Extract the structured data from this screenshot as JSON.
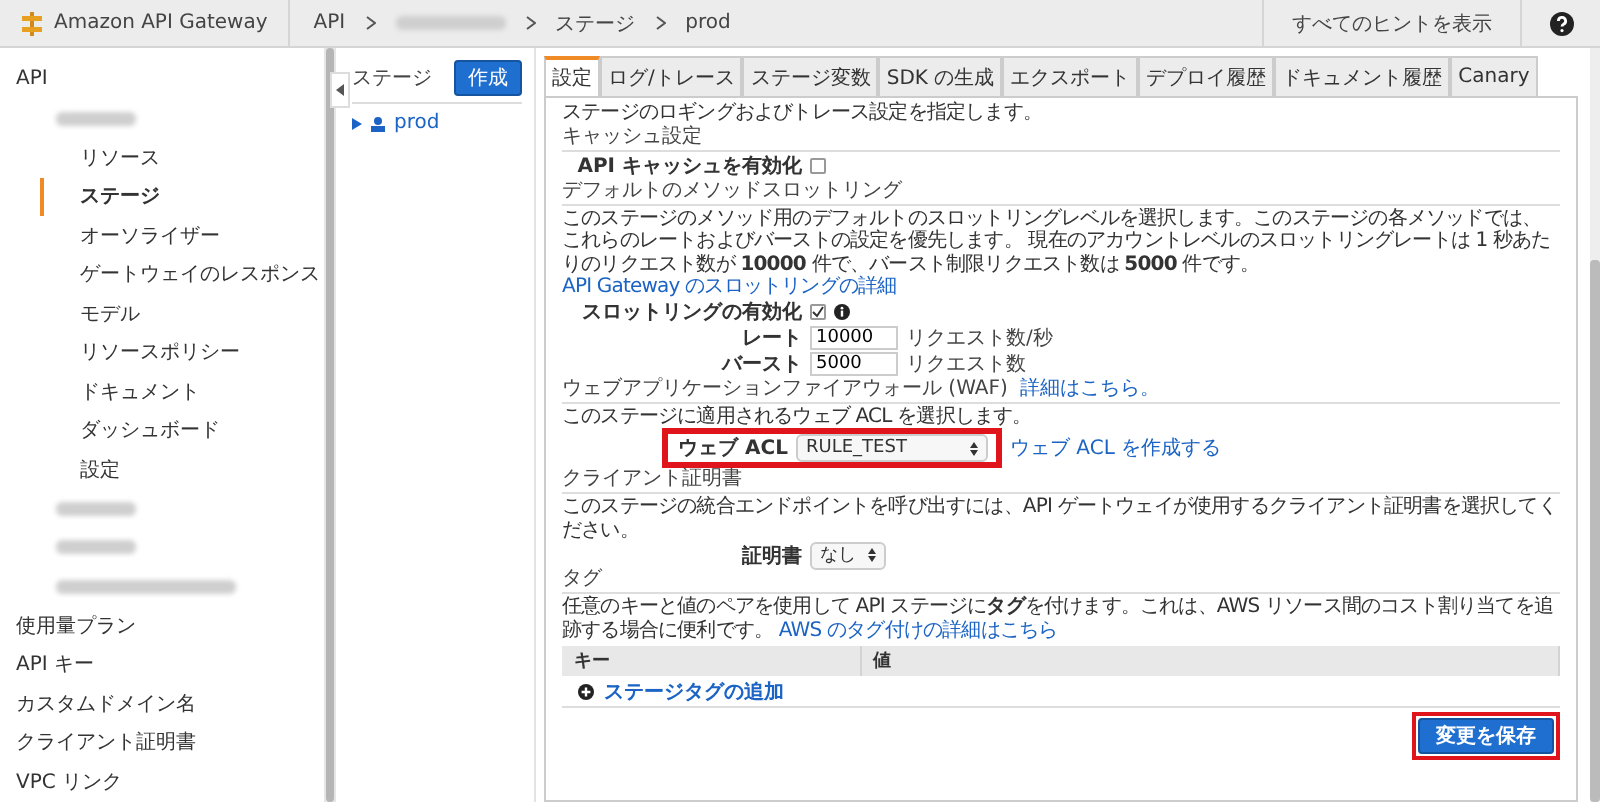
{
  "header": {
    "product": "Amazon API Gateway",
    "breadcrumb": [
      {
        "kind": "text",
        "label": "API"
      },
      {
        "kind": "blurred"
      },
      {
        "kind": "text",
        "label": "ステージ"
      },
      {
        "kind": "text",
        "label": "prod"
      }
    ],
    "hints_button": "すべてのヒントを表示"
  },
  "sidebar": {
    "items": [
      {
        "kind": "text",
        "label": "API",
        "selected": false,
        "children": [
          {
            "kind": "blurred",
            "selected": false,
            "children": [
              {
                "kind": "text",
                "label": "リソース",
                "selected": false
              },
              {
                "kind": "text",
                "label": "ステージ",
                "selected": true
              },
              {
                "kind": "text",
                "label": "オーソライザー",
                "selected": false
              },
              {
                "kind": "text",
                "label": "ゲートウェイのレスポンス",
                "selected": false
              },
              {
                "kind": "text",
                "label": "モデル",
                "selected": false
              },
              {
                "kind": "text",
                "label": "リソースポリシー",
                "selected": false
              },
              {
                "kind": "text",
                "label": "ドキュメント",
                "selected": false
              },
              {
                "kind": "text",
                "label": "ダッシュボード",
                "selected": false
              },
              {
                "kind": "text",
                "label": "設定",
                "selected": false
              }
            ]
          },
          {
            "kind": "blurred",
            "selected": false
          },
          {
            "kind": "blurred",
            "selected": false
          },
          {
            "kind": "blurred",
            "selected": false
          }
        ]
      },
      {
        "kind": "text",
        "label": "使用量プラン",
        "selected": false
      },
      {
        "kind": "text",
        "label": "API キー",
        "selected": false
      },
      {
        "kind": "text",
        "label": "カスタムドメイン名",
        "selected": false
      },
      {
        "kind": "text",
        "label": "クライアント証明書",
        "selected": false
      },
      {
        "kind": "text",
        "label": "VPC リンク",
        "selected": false
      }
    ]
  },
  "stages": {
    "title": "ステージ",
    "create_button": "作成",
    "items": [
      {
        "label": "prod",
        "expanded": false
      }
    ]
  },
  "tabs": [
    {
      "label": "設定",
      "selected": true
    },
    {
      "label": "ログ/トレース",
      "selected": false
    },
    {
      "label": "ステージ変数",
      "selected": false
    },
    {
      "label": "SDK の生成",
      "selected": false
    },
    {
      "label": "エクスポート",
      "selected": false
    },
    {
      "label": "デプロイ履歴",
      "selected": false
    },
    {
      "label": "ドキュメント履歴",
      "selected": false
    },
    {
      "label": "Canary",
      "selected": false
    }
  ],
  "settings": {
    "intro": "ステージのロギングおよびトレース設定を指定します。",
    "cache": {
      "heading": "キャッシュ設定",
      "label": "API キャッシュを有効化",
      "checked": false
    },
    "throttling": {
      "heading": "デフォルトのメソッドスロットリング",
      "description": "このステージのメソッド用のデフォルトのスロットリングレベルを選択します。このステージの各メソッドでは、これらのレートおよびバーストの設定を優先します。 現在のアカウントレベルのスロットリングレートは 1 秒あたりのリクエスト数が **10000** 件で、バースト制限リクエスト数は **5000** 件です。",
      "link": "API Gateway のスロットリングの詳細",
      "enable_label": "スロットリングの有効化",
      "enabled": true,
      "rate_label": "レート",
      "rate_value": "10000",
      "rate_unit": "リクエスト数/秒",
      "burst_label": "バースト",
      "burst_value": "5000",
      "burst_unit": "リクエスト数"
    },
    "waf": {
      "heading": "ウェブアプリケーションファイアウォール (WAF)",
      "link": "詳細はこちら。",
      "description": "このステージに適用されるウェブ ACL を選択します。",
      "acl_label": "ウェブ ACL",
      "acl_value": "RULE_TEST",
      "highlighted": true,
      "create_link": "ウェブ ACL を作成する"
    },
    "client_cert": {
      "heading": "クライアント証明書",
      "description": "このステージの統合エンドポイントを呼び出すには、API ゲートウェイが使用するクライアント証明書を選択してください。",
      "label": "証明書",
      "value": "なし"
    },
    "tags": {
      "heading": "タグ",
      "description": "任意のキーと値のペアを使用して API ステージに**タグ**を付けます。これは、AWS リソース間のコスト割り当てを追跡する場合に便利です。",
      "link": "AWS のタグ付けの詳細はこちら",
      "columns": [
        "キー",
        "値"
      ],
      "add_link": "ステージタグの追加"
    },
    "save_button": {
      "label": "変更を保存",
      "highlighted": true
    }
  }
}
